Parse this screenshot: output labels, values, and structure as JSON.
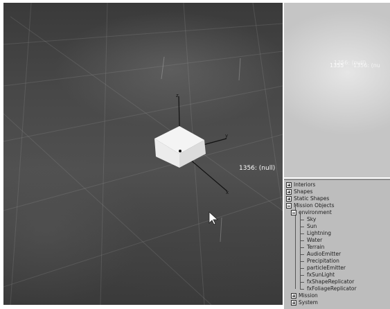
{
  "viewport": {
    "object_label": "1356: (null)"
  },
  "preview": {
    "ghost_labels": [
      "1355",
      "1356: (null)",
      "1356: (nu"
    ]
  },
  "tree": {
    "items": [
      {
        "label": "Interiors",
        "expanded": false
      },
      {
        "label": "Shapes",
        "expanded": false
      },
      {
        "label": "Static Shapes",
        "expanded": false
      },
      {
        "label": "Mission Objects",
        "expanded": true
      },
      {
        "label": "environment",
        "expanded": true
      },
      {
        "label": "Sky"
      },
      {
        "label": "Sun"
      },
      {
        "label": "Lightning"
      },
      {
        "label": "Water"
      },
      {
        "label": "Terrain"
      },
      {
        "label": "AudioEmitter"
      },
      {
        "label": "Precipitation"
      },
      {
        "label": "particleEmitter"
      },
      {
        "label": "fxSunLight"
      },
      {
        "label": "fxShapeReplicator"
      },
      {
        "label": "fxFoliageReplicator"
      },
      {
        "label": "Mission",
        "expanded": false
      },
      {
        "label": "System",
        "expanded": false
      }
    ]
  },
  "colors": {
    "viewport_bg": "#454545",
    "panel_bg": "#bdbdbd",
    "preview_bg": "#d6d6d6"
  }
}
